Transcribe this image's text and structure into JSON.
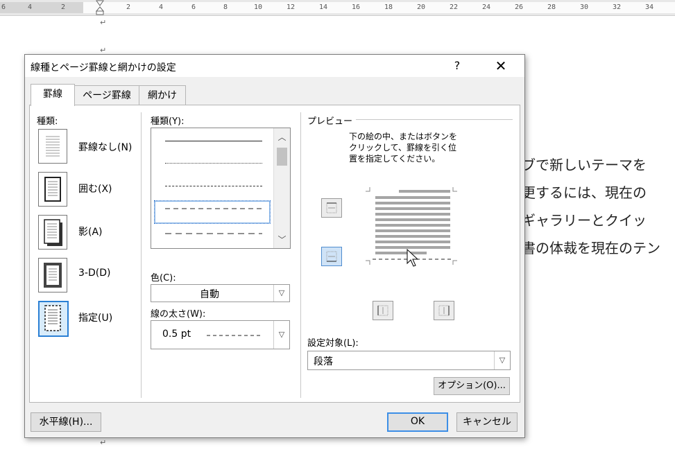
{
  "ruler": {
    "numbers": [
      "6",
      "4",
      "2",
      "2",
      "4",
      "6",
      "8",
      "10",
      "12",
      "14",
      "16",
      "18",
      "20",
      "22",
      "24",
      "26",
      "28",
      "30",
      "32",
      "34"
    ]
  },
  "document": {
    "lines": [
      "ブで新しいテーマを",
      "更するには、現在の",
      "ギャラリーとクイッ",
      "書の体裁を現在のテン"
    ],
    "paragraph_mark": "↵"
  },
  "dialog": {
    "title": "線種とページ罫線と網かけの設定",
    "help": "?",
    "close": "✕",
    "tabs": [
      "罫線",
      "ページ罫線",
      "網かけ"
    ],
    "active_tab": "罫線",
    "setting": {
      "label": "種類:",
      "options": [
        "罫線なし(N)",
        "囲む(X)",
        "影(A)",
        "3-D(D)",
        "指定(U)"
      ],
      "selected": "指定(U)"
    },
    "style": {
      "label": "種類(Y):",
      "color_label": "色(C):",
      "color_value": "自動",
      "width_label": "線の太さ(W):",
      "width_value": "0.5 pt"
    },
    "preview": {
      "label": "プレビュー",
      "instructions": [
        "下の絵の中、またはボタンを",
        "クリックして、罫線を引く位",
        "置を指定してください。"
      ],
      "apply_label": "設定対象(L):",
      "apply_value": "段落",
      "options_button": "オプション(O)..."
    },
    "buttons": {
      "horizontal_line": "水平線(H)...",
      "ok": "OK",
      "cancel": "キャンセル"
    },
    "accent_color": "#2a7fd4"
  }
}
